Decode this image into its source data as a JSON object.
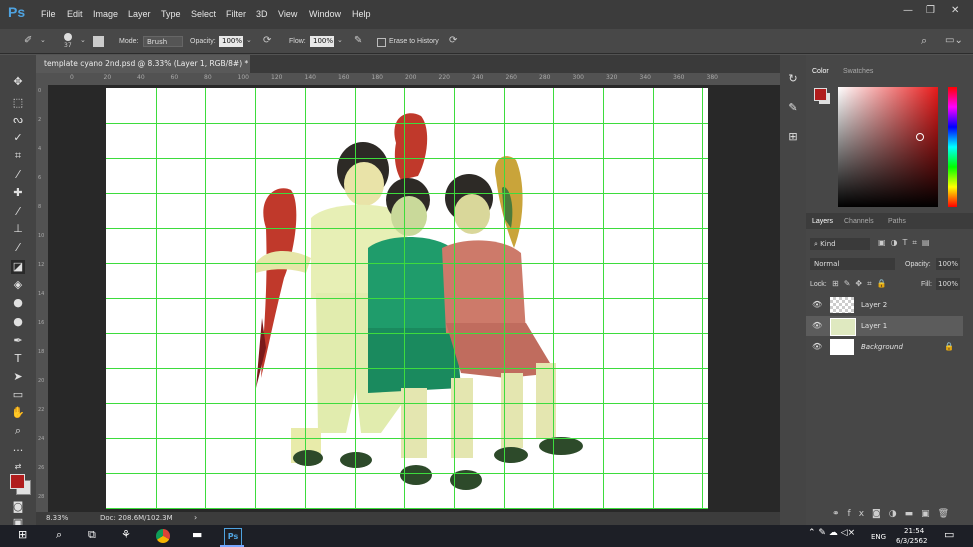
{
  "app": {
    "logo": "Ps"
  },
  "menu": [
    "File",
    "Edit",
    "Image",
    "Layer",
    "Type",
    "Select",
    "Filter",
    "3D",
    "View",
    "Window",
    "Help"
  ],
  "options": {
    "brush_size": "37",
    "mode_label": "Mode:",
    "mode_value": "Brush",
    "opacity_label": "Opacity:",
    "opacity_value": "100%",
    "flow_label": "Flow:",
    "flow_value": "100%",
    "erase_history": "Erase to History"
  },
  "document": {
    "tab_title": "template cyano 2nd.psd @ 8.33% (Layer 1, RGB/8#) *",
    "close": "×"
  },
  "ruler": {
    "h_ticks": [
      "0",
      "20",
      "40",
      "60",
      "80",
      "100",
      "120",
      "140",
      "160",
      "180",
      "200",
      "220",
      "240",
      "260",
      "280",
      "300",
      "320",
      "340",
      "360",
      "380"
    ],
    "v_ticks": [
      "0",
      "2",
      "4",
      "6",
      "8",
      "10",
      "12",
      "14",
      "16",
      "18",
      "20",
      "22",
      "24",
      "26",
      "28"
    ]
  },
  "status": {
    "zoom": "8.33%",
    "doc": "Doc: 208.6M/102.3M",
    "arrow": "›"
  },
  "color_panel": {
    "tabs": [
      "Color",
      "Swatches"
    ],
    "foreground": "#b01c1c",
    "background": "#e0e0e0"
  },
  "layers_panel": {
    "tabs": [
      "Layers",
      "Channels",
      "Paths"
    ],
    "filter_kind": "Kind",
    "blend_mode": "Normal",
    "opacity_label": "Opacity:",
    "opacity_value": "100%",
    "lock_label": "Lock:",
    "fill_label": "Fill:",
    "fill_value": "100%",
    "layers": [
      {
        "name": "Layer 2",
        "selected": false
      },
      {
        "name": "Layer 1",
        "selected": true
      },
      {
        "name": "Background",
        "selected": false,
        "locked": true
      }
    ],
    "footer_icons": [
      "link-icon",
      "fx-icon",
      "mask-icon",
      "adjustment-icon",
      "folder-icon",
      "new-layer-icon",
      "trash-icon"
    ]
  },
  "taskbar": {
    "time": "21:54",
    "date": "6/3/2562",
    "lang": "ENG",
    "app_label": "Ps"
  }
}
